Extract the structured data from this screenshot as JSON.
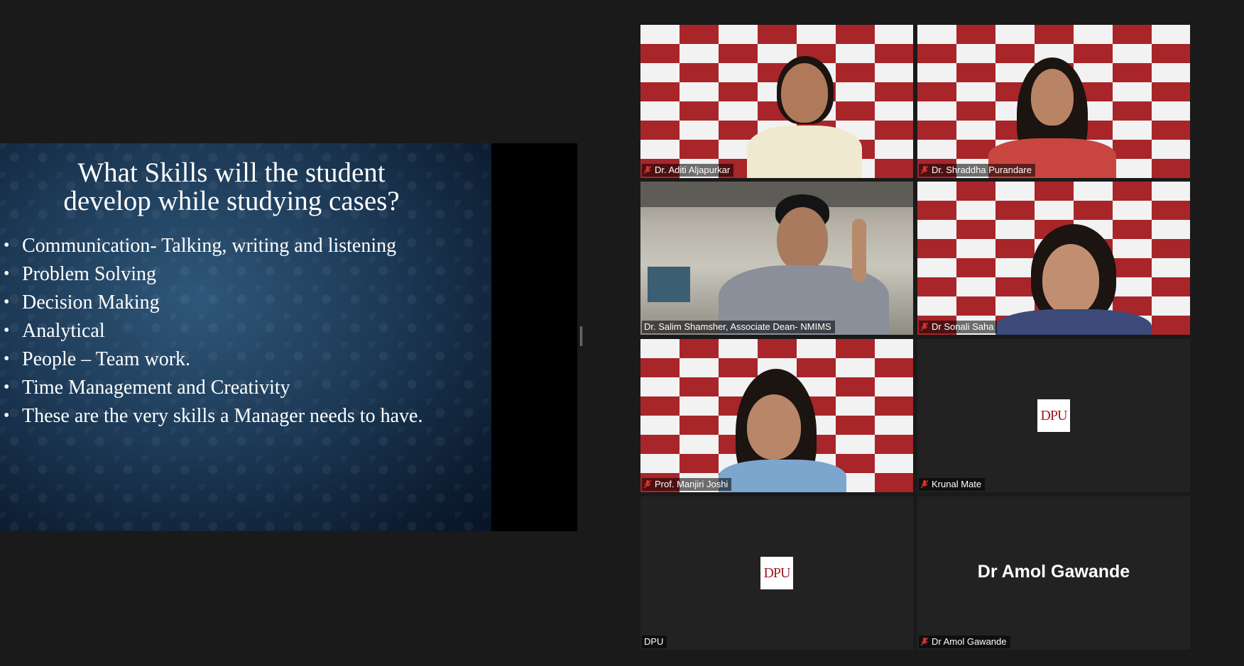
{
  "slide": {
    "title_line1": "What Skills will the student",
    "title_line2": "develop while studying cases?",
    "bullets": [
      "Communication- Talking, writing and listening",
      "Problem Solving",
      "Decision Making",
      "Analytical",
      "People – Team work.",
      "Time Management and Creativity",
      "These are the very skills a Manager needs to have."
    ]
  },
  "participants": [
    {
      "name": "Dr. Aditi Aljapurkar",
      "muted": true,
      "video": "backdrop"
    },
    {
      "name": "Dr. Shraddha Purandare",
      "muted": true,
      "video": "backdrop"
    },
    {
      "name": "Dr. Salim Shamsher, Associate Dean- NMIMS",
      "muted": false,
      "video": "office",
      "active_speaker": true
    },
    {
      "name": "Dr Sonali Saha",
      "muted": true,
      "video": "backdrop"
    },
    {
      "name": "Prof. Manjiri Joshi",
      "muted": true,
      "video": "backdrop"
    },
    {
      "name": "Krunal Mate",
      "muted": true,
      "video": "logo",
      "logo_text": "DPU"
    },
    {
      "name": "DPU",
      "muted": false,
      "video": "logo",
      "logo_text": "DPU"
    },
    {
      "name": "Dr Amol Gawande",
      "muted": true,
      "video": "name",
      "display_name": "Dr Amol Gawande"
    }
  ],
  "colors": {
    "active_speaker_border": "#c8e65a",
    "muted_icon": "#e0322c",
    "backdrop_red": "#a8252a"
  }
}
